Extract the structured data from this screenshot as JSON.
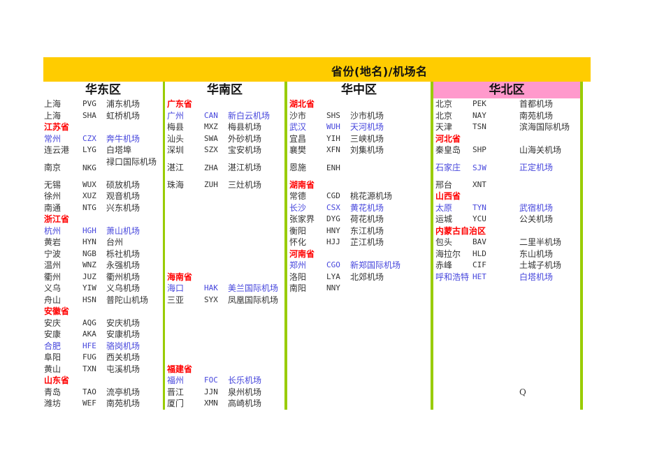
{
  "title": "省份(地名)/机场名",
  "colors": {
    "banner": "#ffcc00",
    "border": "#99cc00",
    "north_header": "#ff99cc",
    "province": "#ff0000",
    "highlight": "#4646dc"
  },
  "regions": [
    {
      "name": "华东区",
      "rows": [
        {
          "city": "上海",
          "code": "PVG",
          "airport": "浦东机场"
        },
        {
          "city": "上海",
          "code": "SHA",
          "airport": "虹桥机场"
        },
        {
          "province": "江苏省"
        },
        {
          "city": "常州",
          "code": "CZX",
          "airport": "奔牛机场",
          "hl": true
        },
        {
          "city": "连云港",
          "code": "LYG",
          "airport": "白塔埠"
        },
        {
          "city": "南京",
          "code": "NKG",
          "airport": "禄口国际机场"
        },
        {
          "city": "无锡",
          "code": "WUX",
          "airport": "硕放机场"
        },
        {
          "city": "徐州",
          "code": "XUZ",
          "airport": "观音机场"
        },
        {
          "city": "南通",
          "code": "NTG",
          "airport": "兴东机场"
        },
        {
          "province": "浙江省"
        },
        {
          "city": "杭州",
          "code": "HGH",
          "airport": "萧山机场",
          "hl": true
        },
        {
          "city": "黄岩",
          "code": "HYN",
          "airport": "台州"
        },
        {
          "city": "宁波",
          "code": "NGB",
          "airport": "栎社机场"
        },
        {
          "city": "温州",
          "code": "WNZ",
          "airport": "永强机场"
        },
        {
          "city": "衢州",
          "code": "JUZ",
          "airport": "衢州机场"
        },
        {
          "city": "义乌",
          "code": "YIW",
          "airport": "义乌机场"
        },
        {
          "city": "舟山",
          "code": "HSN",
          "airport": "普陀山机场"
        },
        {
          "province": "安徽省"
        },
        {
          "city": "安庆",
          "code": "AQG",
          "airport": "安庆机场"
        },
        {
          "city": "安康",
          "code": "AKA",
          "airport": "安康机场"
        },
        {
          "city": "合肥",
          "code": "HFE",
          "airport": "骆岗机场",
          "hl": true
        },
        {
          "city": "阜阳",
          "code": "FUG",
          "airport": "西关机场"
        },
        {
          "city": "黄山",
          "code": "TXN",
          "airport": "屯溪机场"
        },
        {
          "province": "山东省"
        },
        {
          "city": "青岛",
          "code": "TAO",
          "airport": "流亭机场"
        },
        {
          "city": "潍坊",
          "code": "WEF",
          "airport": "南苑机场"
        }
      ]
    },
    {
      "name": "华南区",
      "rows": [
        {
          "province": "广东省"
        },
        {
          "city": "广州",
          "code": "CAN",
          "airport": "新白云机场",
          "hl": true
        },
        {
          "city": "梅县",
          "code": "MXZ",
          "airport": "梅县机场"
        },
        {
          "city": "汕头",
          "code": "SWA",
          "airport": "外砂机场"
        },
        {
          "city": "深圳",
          "code": "SZX",
          "airport": "宝安机场"
        },
        {
          "city": "湛江",
          "code": "ZHA",
          "airport": "湛江机场"
        },
        {
          "city": "珠海",
          "code": "ZUH",
          "airport": "三灶机场"
        },
        {},
        {},
        {},
        {},
        {},
        {},
        {},
        {
          "province": "海南省"
        },
        {
          "city": "海口",
          "code": "HAK",
          "airport": "美兰国际机场",
          "hl": true
        },
        {
          "city": "三亚",
          "code": "SYX",
          "airport": "凤凰国际机场"
        },
        {},
        {},
        {},
        {},
        {},
        {
          "province": "福建省"
        },
        {
          "city": "福州",
          "code": "FOC",
          "airport": "长乐机场",
          "hl": true
        },
        {
          "city": "晋江",
          "code": "JJN",
          "airport": "泉州机场"
        },
        {
          "city": "厦门",
          "code": "XMN",
          "airport": "高崎机场"
        }
      ]
    },
    {
      "name": "华中区",
      "rows": [
        {
          "province": "湖北省"
        },
        {
          "city": "沙市",
          "code": "SHS",
          "airport": "沙市机场"
        },
        {
          "city": "武汉",
          "code": "WUH",
          "airport": "天河机场",
          "hl": true
        },
        {
          "city": "宜昌",
          "code": "YIH",
          "airport": "三峡机场"
        },
        {
          "city": "襄樊",
          "code": "XFN",
          "airport": "刘集机场"
        },
        {
          "city": "恩施",
          "code": "ENH"
        },
        {
          "province": "湖南省"
        },
        {
          "city": "常德",
          "code": "CGD",
          "airport": "桃花源机场"
        },
        {
          "city": "长沙",
          "code": "CSX",
          "airport": "黄花机场",
          "hl": true
        },
        {
          "city": "张家界",
          "code": "DYG",
          "airport": "荷花机场"
        },
        {
          "city": "衡阳",
          "code": "HNY",
          "airport": "东江机场"
        },
        {
          "city": "怀化",
          "code": "HJJ",
          "airport": "芷江机场"
        },
        {
          "province": "河南省"
        },
        {
          "city": "郑州",
          "code": "CGO",
          "airport": "新郑国际机场",
          "hl": true
        },
        {
          "city": "洛阳",
          "code": "LYA",
          "airport": "北郊机场"
        },
        {
          "city": "南阳",
          "code": "NNY"
        }
      ]
    },
    {
      "name": "华北区",
      "rows": [
        {
          "city": "北京",
          "code": "PEK",
          "airport": "首都机场"
        },
        {
          "city": "北京",
          "code": "NAY",
          "airport": "南苑机场"
        },
        {
          "city": "天津",
          "code": "TSN",
          "airport": "滨海国际机场"
        },
        {
          "province": "河北省"
        },
        {
          "city": "秦皇岛",
          "code": "SHP",
          "airport": "山海关机场"
        },
        {
          "city": "石家庄",
          "code": "SJW",
          "airport": "正定机场",
          "hl": true
        },
        {
          "city": "邢台",
          "code": "XNT"
        },
        {
          "province": "山西省"
        },
        {
          "city": "太原",
          "code": "TYN",
          "airport": "武宿机场",
          "hl": true
        },
        {
          "city": "运城",
          "code": "YCU",
          "airport": "公关机场"
        },
        {
          "province": "内蒙古自治区"
        },
        {
          "city": "包头",
          "code": "BAV",
          "airport": "二里半机场"
        },
        {
          "city": "海拉尔",
          "code": "HLD",
          "airport": "东山机场"
        },
        {
          "city": "赤峰",
          "code": "CIF",
          "airport": "土城子机场"
        },
        {
          "city": "呼和浩特",
          "code": "HET",
          "airport": "白塔机场",
          "hl": true
        },
        {},
        {},
        {},
        {},
        {},
        {},
        {},
        {},
        {},
        {
          "airport": "Q"
        }
      ]
    }
  ]
}
